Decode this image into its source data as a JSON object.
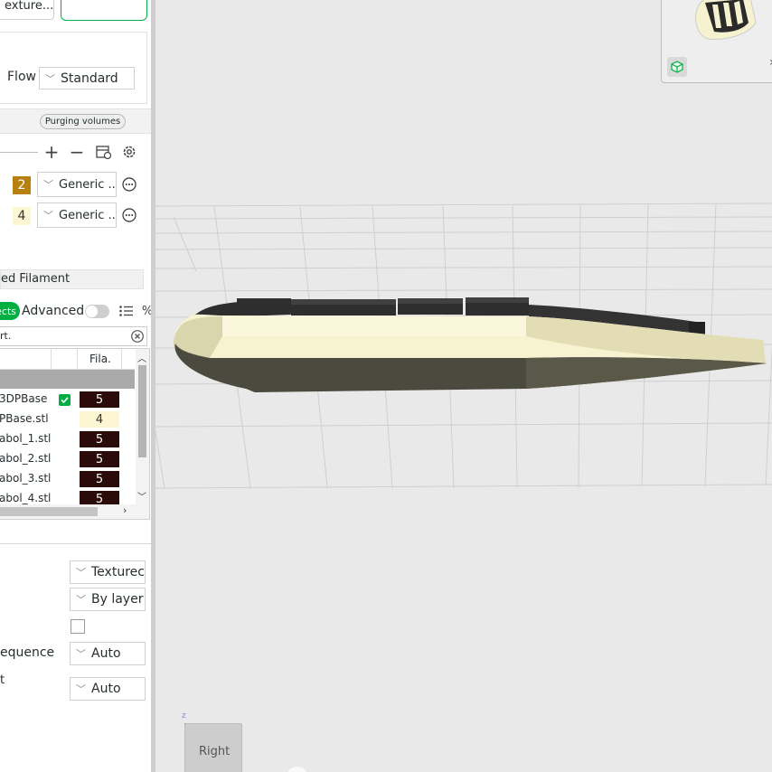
{
  "top": {
    "texture_button": "exture...",
    "flow_label": "Flow",
    "flow_value": "Standard"
  },
  "filament": {
    "purging_button": "Purging volumes",
    "items": [
      {
        "index": "2",
        "color": "#b8800f",
        "text_color": "#ffffff",
        "preset": "Generic ..."
      },
      {
        "index": "4",
        "color": "#fcf7d2",
        "text_color": "#333333",
        "preset": "Generic ..."
      }
    ],
    "section_label": "ed Filament"
  },
  "objects": {
    "tab_label": "ects",
    "advanced_label": "Advanced",
    "search_text": "rt.",
    "col_fila": "Fila.",
    "rows": [
      {
        "name": "3DPBase",
        "fila": "5",
        "color": "#2b0a0a",
        "text_color": "#ffffff",
        "check": true
      },
      {
        "name": "PBase.stl",
        "fila": "4",
        "color": "#fcf7d2",
        "text_color": "#333333",
        "check": false
      },
      {
        "name": "abol_1.stl",
        "fila": "5",
        "color": "#2b0a0a",
        "text_color": "#ffffff",
        "check": false
      },
      {
        "name": "abol_2.stl",
        "fila": "5",
        "color": "#2b0a0a",
        "text_color": "#ffffff",
        "check": false
      },
      {
        "name": "abol_3.stl",
        "fila": "5",
        "color": "#2b0a0a",
        "text_color": "#ffffff",
        "check": false
      },
      {
        "name": "abol_4.stl",
        "fila": "5",
        "color": "#2b0a0a",
        "text_color": "#ffffff",
        "check": false
      }
    ]
  },
  "plate": {
    "plate_type": "Texturec",
    "print_sequence_mode": "By layer",
    "sequence_label": "equence",
    "sequence_value": "Auto",
    "last_label": "t",
    "last_value": "Auto"
  },
  "view": {
    "axis_label": "z",
    "view_button": "Right"
  },
  "colors": {
    "accent": "#00ae42",
    "swatch_dark": "#2b0a0a",
    "swatch_cream": "#fcf7d2",
    "swatch_gold": "#b8800f"
  }
}
